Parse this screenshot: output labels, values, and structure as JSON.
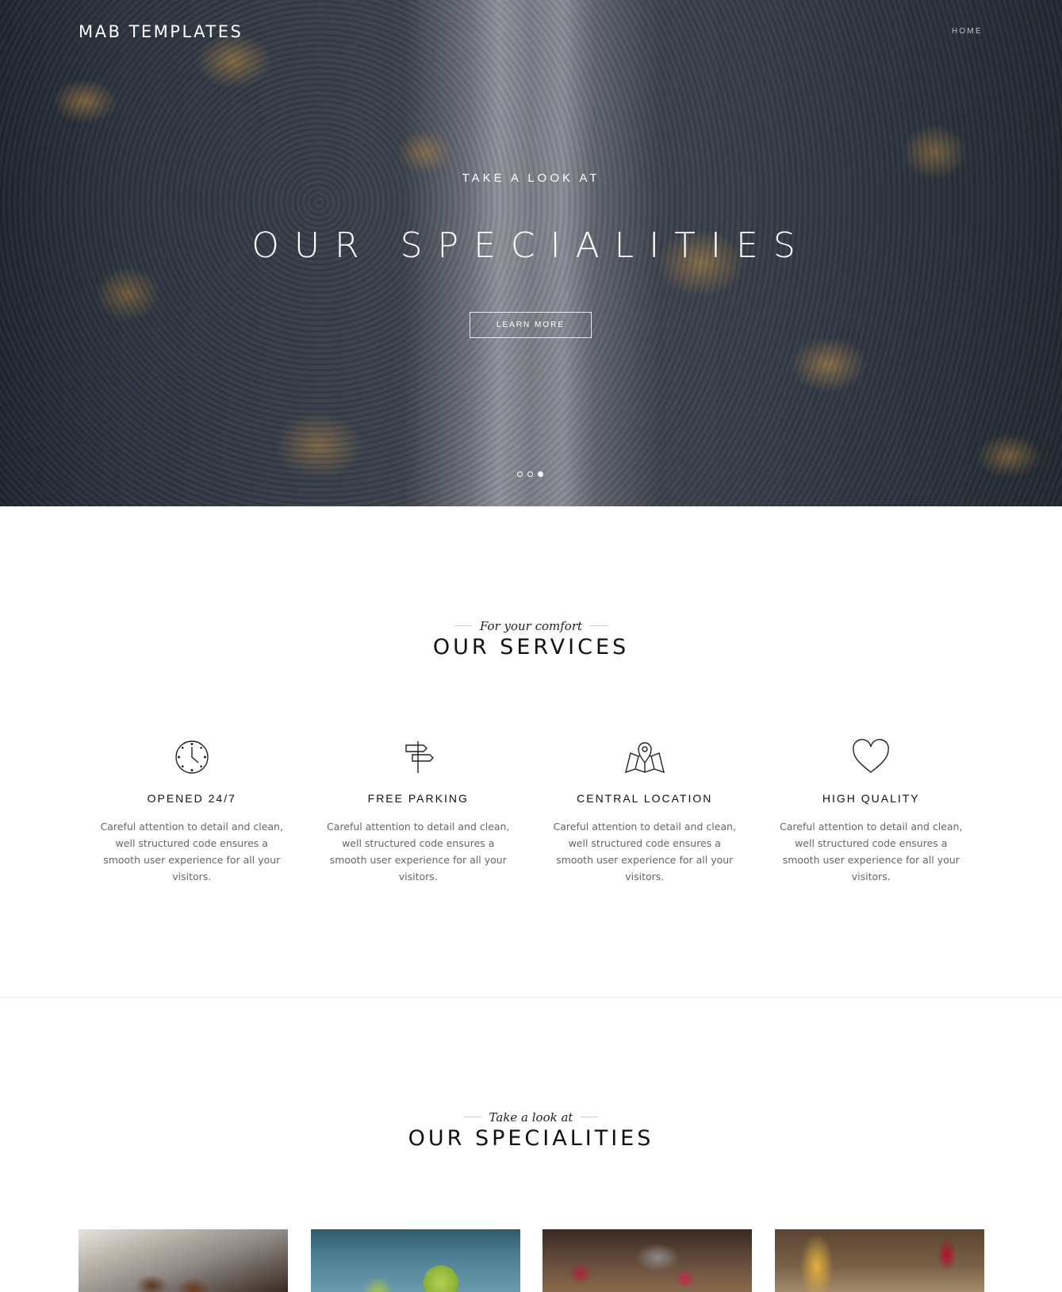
{
  "header": {
    "logo": "MAB TEMPLATES",
    "nav": [
      "HOME"
    ]
  },
  "hero": {
    "kicker": "TAKE A LOOK AT",
    "title": "OUR SPECIALITIES",
    "button_label": "LEARN MORE",
    "slides": 3,
    "active_slide": 3
  },
  "services_section": {
    "subtitle": "For your comfort",
    "title": "OUR SERVICES",
    "items": [
      {
        "icon": "clock-icon",
        "title": "OPENED 24/7",
        "text": "Careful attention to detail and clean, well structured code ensures a smooth user experience for all your visitors."
      },
      {
        "icon": "signpost-icon",
        "title": "FREE PARKING",
        "text": "Careful attention to detail and clean, well structured code ensures a smooth user experience for all your visitors."
      },
      {
        "icon": "map-pin-icon",
        "title": "CENTRAL LOCATION",
        "text": "Careful attention to detail and clean, well structured code ensures a smooth user experience for all your visitors."
      },
      {
        "icon": "heart-icon",
        "title": "HIGH QUALITY",
        "text": "Careful attention to detail and clean, well structured code ensures a smooth user experience for all your visitors."
      }
    ]
  },
  "specialities_section": {
    "subtitle": "Take a look at",
    "title": "OUR SPECIALITIES",
    "thumbnails": [
      "grill-food-image",
      "limes-image",
      "radishes-image",
      "corn-image"
    ]
  }
}
